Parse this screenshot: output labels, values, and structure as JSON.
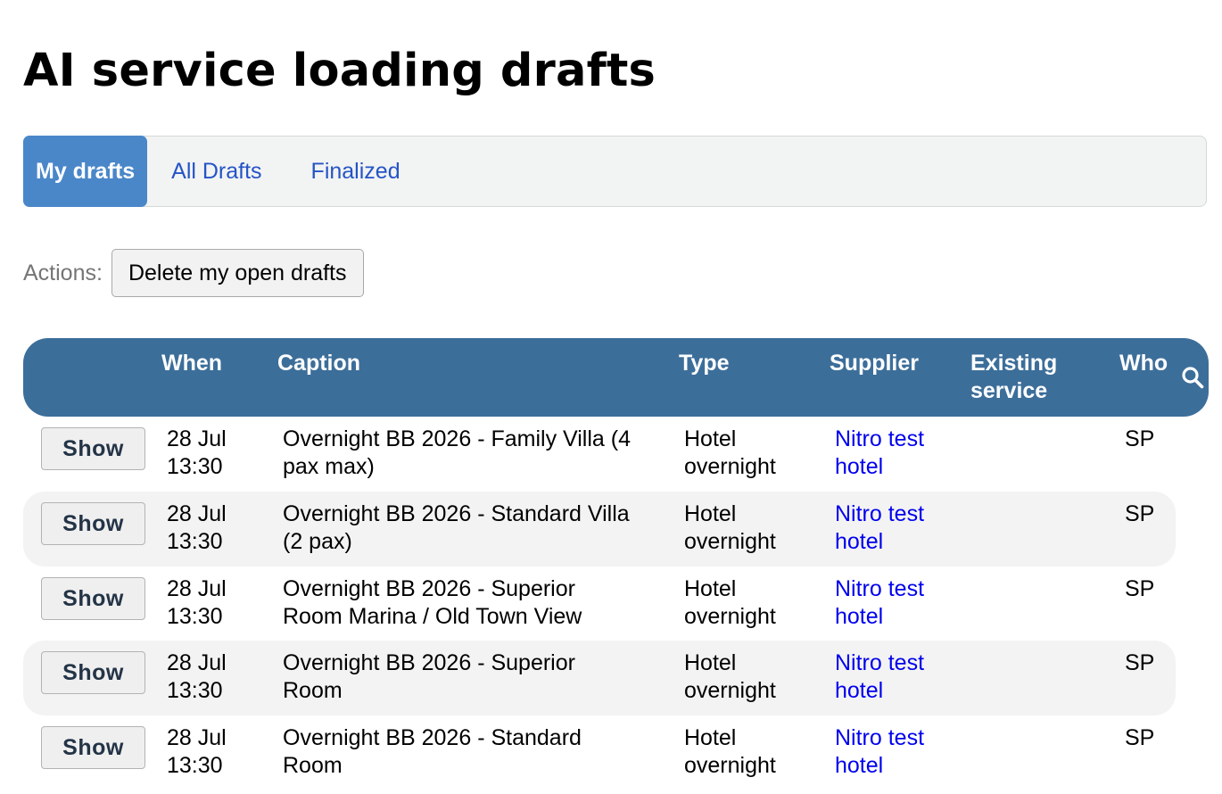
{
  "page": {
    "title": "AI service loading drafts"
  },
  "tabs": [
    {
      "label": "My drafts",
      "active": true
    },
    {
      "label": "All Drafts",
      "active": false
    },
    {
      "label": "Finalized",
      "active": false
    }
  ],
  "actions": {
    "label": "Actions:",
    "delete_button": "Delete my open drafts"
  },
  "table": {
    "headers": {
      "when": "When",
      "caption": "Caption",
      "type": "Type",
      "supplier": "Supplier",
      "existing_line1": "Existing",
      "existing_line2": "service",
      "who": "Who"
    },
    "search_icon": "search-icon",
    "rows": [
      {
        "button": "Show",
        "when_line1": "28 Jul",
        "when_line2": "13:30",
        "caption_line1": "Overnight BB 2026 - Family Villa (4",
        "caption_line2": "pax max)",
        "type_line1": "Hotel",
        "type_line2": "overnight",
        "supplier_line1": "Nitro test",
        "supplier_line2": "hotel",
        "existing": "",
        "who": "SP"
      },
      {
        "button": "Show",
        "when_line1": "28 Jul",
        "when_line2": "13:30",
        "caption_line1": "Overnight BB 2026 - Standard Villa",
        "caption_line2": "(2 pax)",
        "type_line1": "Hotel",
        "type_line2": "overnight",
        "supplier_line1": "Nitro test",
        "supplier_line2": "hotel",
        "existing": "",
        "who": "SP"
      },
      {
        "button": "Show",
        "when_line1": "28 Jul",
        "when_line2": "13:30",
        "caption_line1": "Overnight BB 2026 - Superior",
        "caption_line2": "Room Marina / Old Town View",
        "type_line1": "Hotel",
        "type_line2": "overnight",
        "supplier_line1": "Nitro test",
        "supplier_line2": "hotel",
        "existing": "",
        "who": "SP"
      },
      {
        "button": "Show",
        "when_line1": "28 Jul",
        "when_line2": "13:30",
        "caption_line1": "Overnight BB 2026 - Superior",
        "caption_line2": "Room",
        "type_line1": "Hotel",
        "type_line2": "overnight",
        "supplier_line1": "Nitro test",
        "supplier_line2": "hotel",
        "existing": "",
        "who": "SP"
      },
      {
        "button": "Show",
        "when_line1": "28 Jul",
        "when_line2": "13:30",
        "caption_line1": "Overnight BB 2026 - Standard",
        "caption_line2": "Room",
        "type_line1": "Hotel",
        "type_line2": "overnight",
        "supplier_line1": "Nitro test",
        "supplier_line2": "hotel",
        "existing": "",
        "who": "SP"
      }
    ]
  },
  "colors": {
    "tab_active": "#4a87c9",
    "link": "#2454c6",
    "header_bg": "#3c6e9a",
    "row_shade": "#f3f3f3",
    "supplier_link": "#0000ee"
  }
}
